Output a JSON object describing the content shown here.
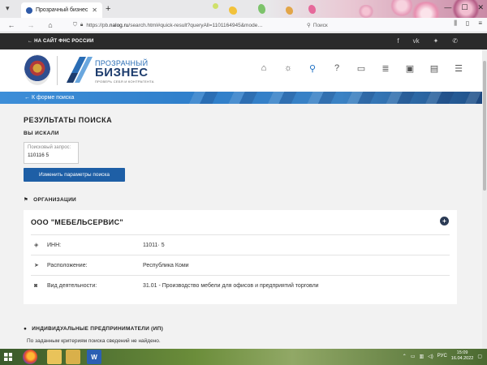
{
  "browser": {
    "tab_title": "Прозрачный бизнес",
    "url_prefix": "https://pb.",
    "url_host": "nalog.ru",
    "url_path": "/search.html#quick-result?queryAll=1101164945&mode…",
    "search_placeholder": "Поиск"
  },
  "site": {
    "back_to_fns": "НА САЙТ ФНС РОССИИ",
    "logo_line1": "ПРОЗРАЧНЫЙ",
    "logo_line2": "БИЗНЕС",
    "logo_tagline": "ПРОВЕРЬ СЕБЯ И КОНТРАГЕНТА",
    "back_to_form": "К форме поиска"
  },
  "results": {
    "title": "РЕЗУЛЬТАТЫ ПОИСКА",
    "you_searched": "ВЫ ИСКАЛИ",
    "query_label": "Поисковый запрос:",
    "query_value": "110116      5",
    "change_button": "Изменить параметры поиска"
  },
  "organizations": {
    "header": "ОРГАНИЗАЦИИ",
    "items": [
      {
        "name": "ООО \"МЕБЕЛЬСЕРВИС\"",
        "inn_label": "ИНН:",
        "inn_value": "11011·       5",
        "location_label": "Расположение:",
        "location_value": "Республика Коми",
        "activity_label": "Вид деятельности:",
        "activity_value": "31.01 - Производство мебели для офисов и предприятий торговли"
      }
    ]
  },
  "ip": {
    "header": "ИНДИВИДУАЛЬНЫЕ ПРЕДПРИНИМАТЕЛИ (ИП)",
    "message": "По заданным критериям поиска сведений не найдено."
  },
  "taskbar": {
    "lang": "РУС",
    "time": "15:09",
    "date": "16.04.2022"
  },
  "colors": {
    "accent": "#1e5fa6",
    "ribbon": "#2f7fcb",
    "top_bar": "#2b2b2b"
  }
}
